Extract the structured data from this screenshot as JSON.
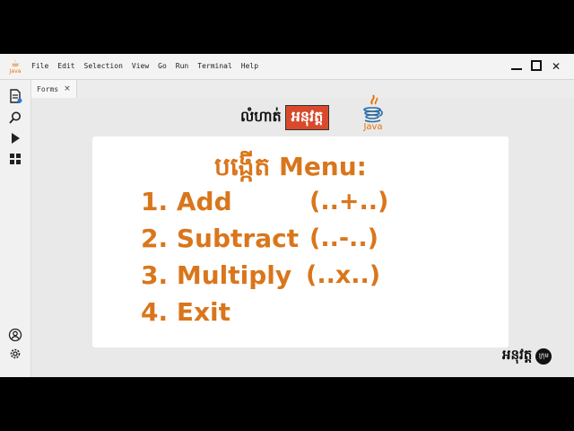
{
  "menubar": {
    "logo_text": "Java",
    "items": [
      "File",
      "Edit",
      "Selection",
      "View",
      "Go",
      "Run",
      "Terminal",
      "Help"
    ]
  },
  "window_controls": {
    "close_label": "✕"
  },
  "tab": {
    "label": "Forms",
    "close_label": "×"
  },
  "header": {
    "title_plain": "លំហាត់",
    "title_box": "អនុវត្ត",
    "java_word": "Java"
  },
  "content": {
    "title": "បង្កើត Menu:",
    "items": [
      {
        "label": "1. Add",
        "op": "(..+..)"
      },
      {
        "label": "2. Subtract",
        "op": "(..-..)"
      },
      {
        "label": "3. Multiply",
        "op": "(..x..)"
      },
      {
        "label": "4. Exit",
        "op": ""
      }
    ]
  },
  "brand": {
    "text": "អនុវត្ត",
    "badge": "ក្រុម"
  },
  "colors": {
    "accent": "#d9761c",
    "title_box": "#d84a2b",
    "java": "#e76f00"
  }
}
